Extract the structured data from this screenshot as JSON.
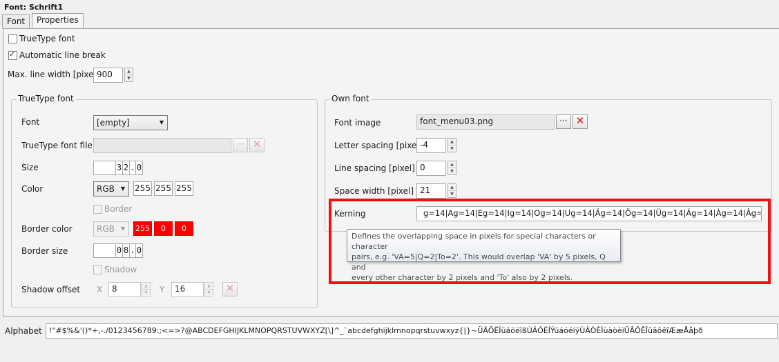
{
  "title": "Font: Schrift1",
  "tabs": [
    {
      "label": "Font"
    },
    {
      "label": "Properties"
    }
  ],
  "options": {
    "truetype_font": "TrueType font",
    "auto_line_break": "Automatic line break",
    "max_line_width_label": "Max. line width [pixel]",
    "max_line_width_value": "900"
  },
  "truetype_group": {
    "title": "TrueType font",
    "font_label": "Font",
    "font_value": "[empty]",
    "file_label": "TrueType font file",
    "file_value": "",
    "size_label": "Size",
    "size_digits": [
      "",
      "3",
      "2",
      ".",
      "0"
    ],
    "color_label": "Color",
    "color_mode": "RGB",
    "color_values": [
      "255",
      "255",
      "255"
    ],
    "border_checkbox": "Border",
    "border_color_label": "Border color",
    "border_color_mode": "RGB",
    "border_color_values": [
      "255",
      "0",
      "0"
    ],
    "border_size_label": "Border size",
    "border_size_digits": [
      "",
      "0",
      "8",
      ".",
      "0"
    ],
    "shadow_checkbox": "Shadow",
    "shadow_offset_label": "Shadow offset",
    "shadow_x_label": "X",
    "shadow_x_value": "8",
    "shadow_y_label": "Y",
    "shadow_y_value": "16"
  },
  "own_group": {
    "title": "Own font",
    "font_image_label": "Font image",
    "font_image_value": "font_menu03.png",
    "letter_spacing_label": "Letter spacing [pixel]",
    "letter_spacing_value": "-4",
    "line_spacing_label": "Line spacing [pixel]",
    "line_spacing_value": "0",
    "space_width_label": "Space width [pixel]",
    "space_width_value": "21",
    "kerning_label": "Kerning",
    "kerning_value": "g=14|Ag=14|Eg=14|Ig=14|Og=14|Ug=14|Äg=14|Ög=14|Üg=14|Ág=14|Àg=14|Âg=14|Úg=14|Ć"
  },
  "tooltip": {
    "line1": "Defines the overlapping space in pixels for special characters or character",
    "line2": "pairs, e.g. 'VA=5|Q=2|To=2'. This would overlap 'VA' by 5 pixels, Q and",
    "line3": "every other character by 2 pixels and 'To' also by 2 pixels."
  },
  "alphabet": {
    "label": "Alphabet",
    "value": "!\"#$%&'()*+,-./0123456789:;<=>?@ABCDEFGHIJKLMNOPQRSTUVWXYZ[\\]^_`abcdefghijklmnopqrstuvwxyz{|}~ÜÄÖËÏüäöëïßÚÁÓÉÍÝúáóéíýÙÀÒÈÌùàòèìÛÂÔÊÎûâôêîÆæÅåþð"
  },
  "colors": {
    "highlight": "#f01010",
    "border_color_fill": "#ff0000"
  }
}
